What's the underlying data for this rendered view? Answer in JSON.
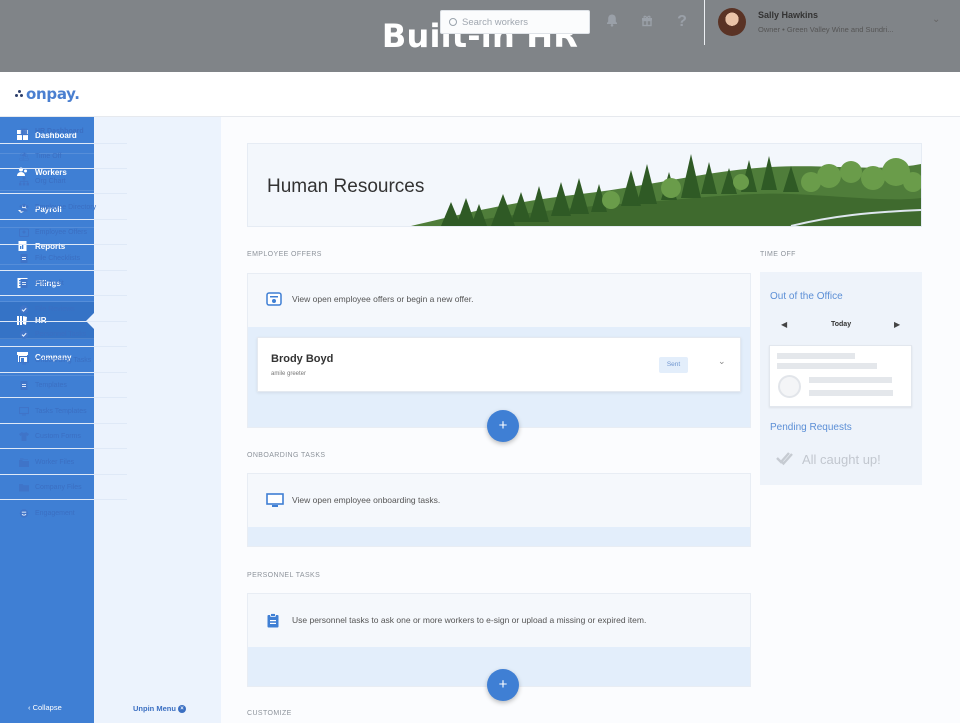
{
  "banner": {
    "title": "Built-in HR"
  },
  "header": {
    "logo": "onpay.",
    "search_placeholder": "Search workers",
    "icons": [
      "bell-icon",
      "gift-icon",
      "help-icon"
    ],
    "help_glyph": "?",
    "user_name": "Sally Hawkins",
    "user_role": "Owner • Green Valley Wine and Sundri..."
  },
  "sidebar": {
    "items": [
      {
        "label": "Dashboard",
        "icon": "dashboard-icon"
      },
      {
        "label": "Workers",
        "icon": "workers-icon"
      },
      {
        "label": "Payroll",
        "icon": "payroll-icon"
      },
      {
        "label": "Reports",
        "icon": "reports-icon"
      },
      {
        "label": "Filings",
        "icon": "filings-icon"
      },
      {
        "label": "HR",
        "icon": "hr-icon",
        "active": true
      },
      {
        "label": "Company",
        "icon": "company-icon"
      }
    ],
    "collapse": "‹ Collapse"
  },
  "submenu": {
    "items": [
      {
        "label": "HR Dashboard",
        "icon": "grid-icon",
        "active": true
      },
      {
        "label": "Time Off",
        "icon": "beach-icon"
      },
      {
        "label": "Org Chart",
        "icon": "org-chart-icon"
      },
      {
        "label": "Employee Directory",
        "icon": "people-icon"
      },
      {
        "label": "Employee Offers",
        "icon": "offer-icon"
      },
      {
        "label": "File Checklists",
        "icon": "checklist-icon"
      },
      {
        "label": "File Audit",
        "icon": "audit-icon"
      },
      {
        "label": "File Reviews",
        "icon": "review-icon"
      },
      {
        "label": "Personnel Tasks",
        "icon": "task-icon"
      },
      {
        "label": "Onboarding Tasks",
        "icon": "monitor-icon"
      },
      {
        "label": "Templates",
        "icon": "template-icon"
      },
      {
        "label": "Tasks Templates",
        "icon": "monitor-icon"
      },
      {
        "label": "Custom Forms",
        "icon": "shirt-icon"
      },
      {
        "label": "Worker Files",
        "icon": "folders-icon"
      },
      {
        "label": "Company Files",
        "icon": "folder-icon"
      },
      {
        "label": "Engagement",
        "icon": "smile-icon"
      }
    ],
    "unpin": "Unpin Menu"
  },
  "main": {
    "hero_title": "Human Resources",
    "employee_offers": {
      "label": "EMPLOYEE OFFERS",
      "intro": "View open employee offers or begin a new offer.",
      "offer": {
        "name": "Brody Boyd",
        "role": "amile greeter",
        "status": "Sent"
      }
    },
    "onboarding": {
      "label": "ONBOARDING TASKS",
      "intro": "View open employee onboarding tasks."
    },
    "personnel": {
      "label": "PERSONNEL TASKS",
      "intro": "Use personnel tasks to ask one or more workers to e-sign or upload a missing or expired item."
    },
    "customize_label": "CUSTOMIZE",
    "add_glyph": "+"
  },
  "time_off": {
    "label": "TIME OFF",
    "out_of_office": "Out of the Office",
    "today": "Today",
    "prev_glyph": "◀",
    "next_glyph": "▶",
    "pending": "Pending Requests",
    "caught_up": "All caught up!"
  },
  "colors": {
    "brand_blue": "#3f7fd4",
    "submenu_bg": "#ecf3fd",
    "banner_gray": "#808488"
  }
}
